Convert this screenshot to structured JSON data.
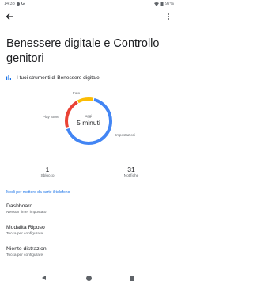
{
  "status_bar": {
    "time": "14:38",
    "battery": "97%"
  },
  "page": {
    "title": "Benessere digitale e Controllo genitori"
  },
  "tools": {
    "label": "I tuoi strumenti di Benessere digitale"
  },
  "donut": {
    "center_label": "oggi",
    "center_value": "5 minuti",
    "segments": [
      {
        "name": "Impostazioni",
        "fraction": 0.66,
        "color": "#4285f4"
      },
      {
        "name": "Play Store",
        "fraction": 0.22,
        "color": "#ea4335"
      },
      {
        "name": "Foto",
        "fraction": 0.12,
        "color": "#fbbc04"
      }
    ],
    "labels": {
      "foto": "Foto",
      "play_store": "Play Store",
      "impostazioni": "Impostazioni"
    }
  },
  "stats": {
    "unlocks": {
      "value": "1",
      "label": "Sblocco"
    },
    "notifications": {
      "value": "31",
      "label": "Notifiche"
    }
  },
  "section": {
    "header": "Modi per mettere da parte il telefono"
  },
  "settings": [
    {
      "title": "Dashboard",
      "subtitle": "Nessun timer impostato"
    },
    {
      "title": "Modalità Riposo",
      "subtitle": "Tocca per configurare"
    },
    {
      "title": "Niente distrazioni",
      "subtitle": "Tocca per configurare"
    }
  ],
  "colors": {
    "accent": "#1a73e8",
    "text": "#202124",
    "secondary": "#5f6368"
  }
}
